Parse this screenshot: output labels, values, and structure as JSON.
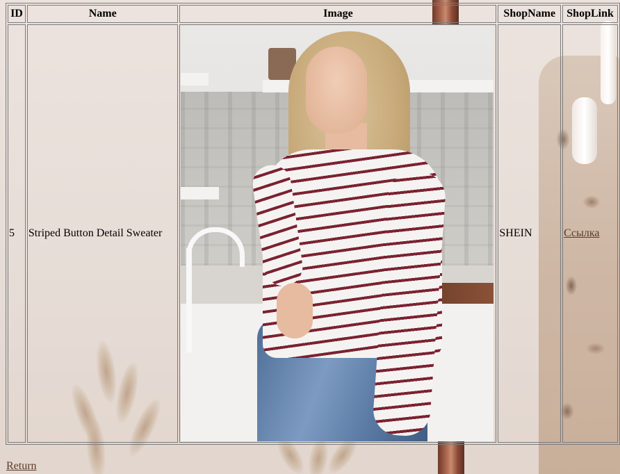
{
  "table": {
    "headers": {
      "id": "ID",
      "name": "Name",
      "image": "Image",
      "shop_name": "ShopName",
      "shop_link": "ShopLink"
    },
    "rows": [
      {
        "id": "5",
        "name": "Striped Button Detail Sweater",
        "image_alt": "",
        "shop_name": "SHEIN",
        "shop_link_label": "Ссылка"
      }
    ]
  },
  "footer": {
    "return_label": "Return"
  },
  "colors": {
    "link": "#5b3a29",
    "border": "#7b7b7b",
    "background": "#ece3de",
    "stripe": "#7b2231"
  }
}
